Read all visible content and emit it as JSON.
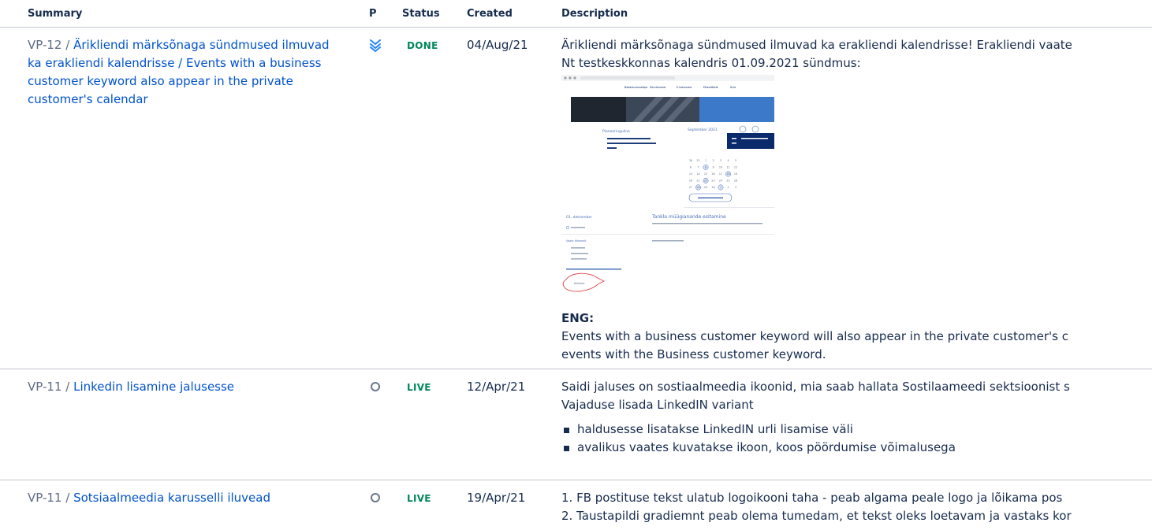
{
  "columns": {
    "summary": "Summary",
    "priority": "P",
    "status": "Status",
    "created": "Created",
    "description": "Description"
  },
  "rows": [
    {
      "key": "VP-12 /",
      "summary": "Ärikliendi märksõnaga sündmused ilmuvad ka erakliendi kalendrisse / Events with a business customer keyword also appear in the private customer's calendar",
      "priority_icon": "lowest-priority-icon",
      "status": "DONE",
      "created": "04/Aug/21",
      "desc_lines": [
        "Ärikliendi märksõnaga sündmused ilmuvad ka erakliendi kalendrisse! Erakliendi vaate",
        "Nt testkeskkonnas kalendris 01.09.2021 sündmus:"
      ],
      "eng_heading": "ENG:",
      "eng_lines": [
        "Events with a business customer keyword will also appear in the private customer's c",
        "events with the Business customer keyword."
      ]
    },
    {
      "key": "VP-11 /",
      "summary": "Linkedin lisamine jalusesse",
      "priority_icon": "circle-priority-icon",
      "status": "LIVE",
      "created": "12/Apr/21",
      "desc_lines": [
        "Saidi jaluses on sostiaalmeedia ikoonid, mia saab hallata Sostilaameedi sektsioonist s",
        "Vajaduse lisada LinkedIN variant"
      ],
      "bullets": [
        "haldusesse lisatakse LinkedIN urli lisamise väli",
        "avalikus vaates kuvatakse ikoon, koos pöördumise võimalusega"
      ]
    },
    {
      "key": "VP-11 /",
      "summary": "Sotsiaalmeedia karusselli iluvead",
      "priority_icon": "circle-priority-icon",
      "status": "LIVE",
      "created": "19/Apr/21",
      "desc_lines": [
        "1. FB postituse tekst ulatub logoikooni taha - peab algama peale logo ja lõikama pos",
        "2. Taustapildi gradiemnt peab olema tumedam, et tekst oleks loetavam ja vastaks kor"
      ]
    }
  ],
  "screenshot": {
    "nav": [
      "Bakalaureuseõpe",
      "Sündmused",
      "E-teenused",
      "Ettevõttele",
      "Ärid"
    ],
    "month": "September 2021",
    "planning_label": "Planeeringuline",
    "event_date": "01. detsember",
    "event_title": "Tankla müügianande esitamine",
    "link_label": "Vaata lähemalt",
    "cal_days": [
      "30",
      "31",
      "1",
      "2",
      "3",
      "4",
      "5",
      "6",
      "7",
      "8",
      "9",
      "10",
      "11",
      "12",
      "13",
      "14",
      "15",
      "16",
      "17",
      "18",
      "19",
      "20",
      "21",
      "22",
      "23",
      "24",
      "25",
      "26",
      "27",
      "28",
      "29",
      "30",
      "1",
      "2",
      "3"
    ],
    "cal_highlighted": [
      "1",
      "8",
      "18",
      "22",
      "28"
    ],
    "circled_label": "äriklient"
  },
  "colors": {
    "link": "#0052cc",
    "status_green": "#00875a",
    "muted": "#5e6c84",
    "priority_blue": "#2684ff",
    "priority_grey": "#6b778c",
    "divider": "#c1c7d0",
    "popup_navy": "#0b2a6b",
    "annotation_red": "#e5484d"
  }
}
